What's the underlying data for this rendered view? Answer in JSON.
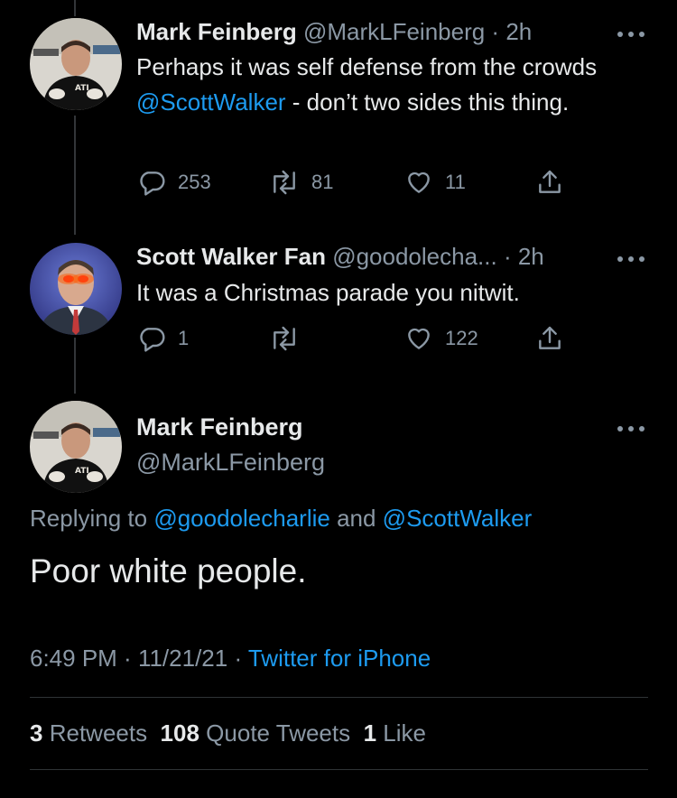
{
  "colors": {
    "background": "#000000",
    "text": "#e7e9ea",
    "secondary": "#8b98a5",
    "link": "#1d9bf0",
    "divider": "#2f3336"
  },
  "tweets": [
    {
      "name": "Mark Feinberg",
      "handle": "@MarkLFeinberg",
      "time": "2h",
      "text_before": "Perhaps it was self defense from the crowds ",
      "mention": "@ScottWalker",
      "text_after": " - don’t two sides this thing.",
      "replies": "253",
      "retweets": "81",
      "likes": "11",
      "avatar_icon": "profile-photo-man-black-shirt"
    },
    {
      "name": "Scott Walker Fan",
      "handle": "@goodolecha...",
      "time": "2h",
      "text": "It was a Christmas parade you nitwit.",
      "replies": "1",
      "retweets": "",
      "likes": "122",
      "avatar_icon": "profile-photo-man-suit-laser-eyes"
    }
  ],
  "main_tweet": {
    "name": "Mark Feinberg",
    "handle": "@MarkLFeinberg",
    "replying_prefix": "Replying to ",
    "replying_to_1": "@goodolecharlie",
    "replying_and": " and ",
    "replying_to_2": "@ScottWalker",
    "text": "Poor white people.",
    "time": "6:49 PM",
    "date": "11/21/21",
    "source": "Twitter for iPhone",
    "retweets_count": "3",
    "retweets_label": "Retweets",
    "quotes_count": "108",
    "quotes_label": "Quote Tweets",
    "likes_count": "1",
    "likes_label": "Like"
  },
  "separator": " · "
}
